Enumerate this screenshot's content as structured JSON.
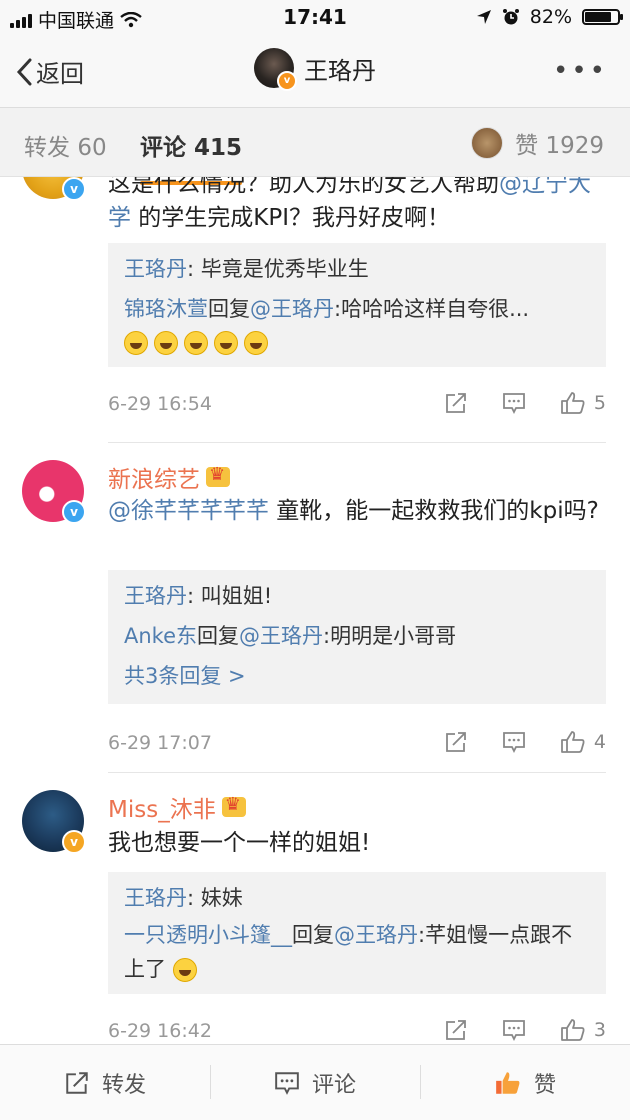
{
  "status_bar": {
    "carrier": "中国联通",
    "time": "17:41",
    "battery": "82%",
    "battery_level": 0.82
  },
  "nav": {
    "back_label": "返回",
    "title": "王珞丹"
  },
  "tabs": {
    "repost_label": "转发",
    "repost_count": "60",
    "comment_label": "评论",
    "comment_count": "415",
    "like_label": "赞",
    "like_count": "1929"
  },
  "comments": [
    {
      "text_a": "这是什么情况？助人为乐的女艺人帮助",
      "mention": "@辽宁大学",
      "text_b": " 的学生完成KPI？我丹好皮啊！",
      "replies": [
        {
          "name": "王珞丹",
          "text": ": 毕竟是优秀毕业生"
        },
        {
          "name": "锦珞沐萱",
          "text": "回复",
          "mention": "@王珞丹",
          "text2": ":哈哈哈这样自夸很..."
        }
      ],
      "emoji": "laughing-crying-emoji",
      "date": "6-29 16:54",
      "likes": "5"
    },
    {
      "author": "新浪综艺",
      "mention": "@徐芊芊芊芊芊",
      "text": " 童靴，能一起救救我们的kpi吗?",
      "replies": [
        {
          "name": "王珞丹",
          "text": ": 叫姐姐!"
        },
        {
          "name": "Anke东",
          "text": "回复",
          "mention": "@王珞丹",
          "text2": ":明明是小哥哥"
        }
      ],
      "more_replies": "共3条回复 >",
      "date": "6-29 17:07",
      "likes": "4"
    },
    {
      "author": "Miss_沐非",
      "text": "我也想要一个一样的姐姐!",
      "replies": [
        {
          "name": "王珞丹",
          "text": ": 妹妹"
        },
        {
          "name": "一只透明小斗篷__",
          "text": "回复",
          "mention": "@王珞丹",
          "text2": ":芊姐慢一点跟不上了"
        }
      ],
      "date": "6-29 16:42",
      "likes": "3"
    }
  ],
  "bottom_bar": {
    "repost": "转发",
    "comment": "评论",
    "like": "赞"
  },
  "colors": {
    "accent": "#f7941d",
    "link": "#507daf",
    "username": "#eb7350",
    "like_active": "#f36b35"
  }
}
